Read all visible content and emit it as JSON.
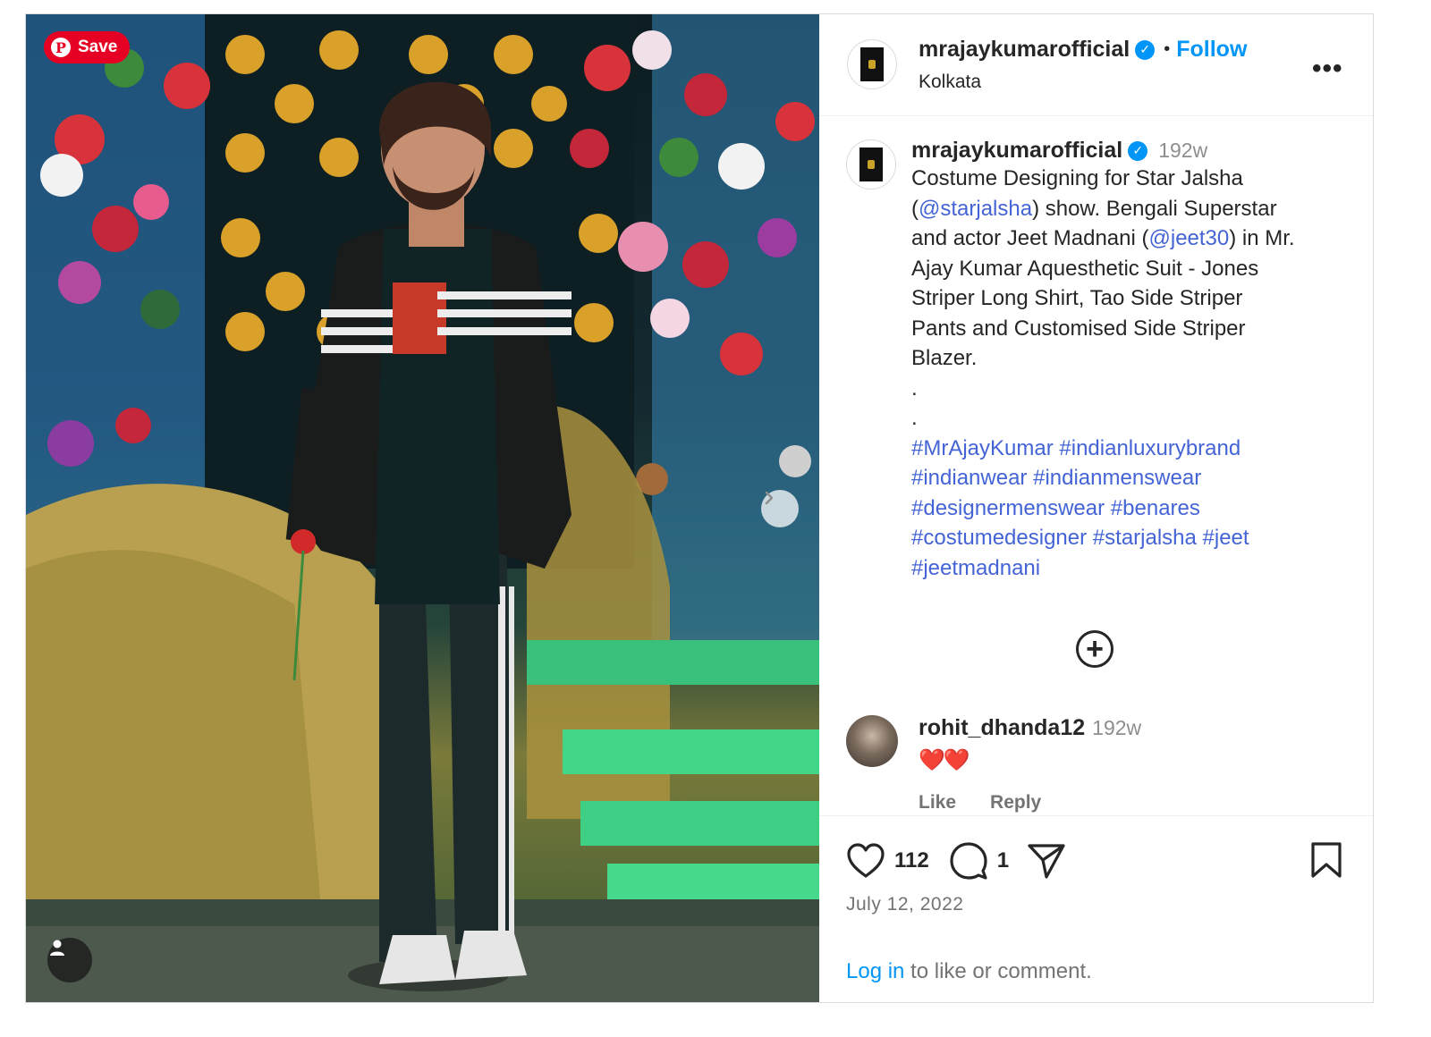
{
  "pinterest": {
    "save_label": "Save"
  },
  "post": {
    "author": "mrajaykumarofficial",
    "follow_label": "Follow",
    "separator": "•",
    "location": "Kolkata",
    "more_label": "•••"
  },
  "caption": {
    "author": "mrajaykumarofficial",
    "time": "192w",
    "line1": "Costume Designing for Star Jalsha",
    "open_paren": "(",
    "mention1": "@starjalsha",
    "line2_rest": ") show. Bengali Superstar",
    "line3_start": "and actor Jeet Madnani (",
    "mention2": "@jeet30",
    "line3_end": ") in Mr.",
    "line4": "Ajay Kumar Aquesthetic Suit - Jones",
    "line5": "Striper Long Shirt, Tao Side Striper",
    "line6": "Pants and Customised Side Striper",
    "line7": "Blazer.",
    "dot1": ".",
    "dot2": ".",
    "hashtags": [
      [
        "#MrAjayKumar",
        "#indianluxurybrand"
      ],
      [
        "#indianwear",
        "#indianmenswear"
      ],
      [
        "#designermenswear",
        "#benares"
      ],
      [
        "#costumedesigner",
        "#starjalsha",
        "#jeet"
      ],
      [
        "#jeetmadnani"
      ]
    ]
  },
  "load_more_label": "+",
  "comment": {
    "user": "rohit_dhanda12",
    "time": "192w",
    "text": "❤️❤️",
    "like_label": "Like",
    "reply_label": "Reply"
  },
  "stats": {
    "likes": "112",
    "comments": "1",
    "date": "July 12, 2022"
  },
  "login_prompt": {
    "link": "Log in",
    "rest": " to like or comment."
  },
  "colors": {
    "link_blue": "#0095f6",
    "hashtag_blue": "#4464d6",
    "pinterest_red": "#e60023"
  }
}
